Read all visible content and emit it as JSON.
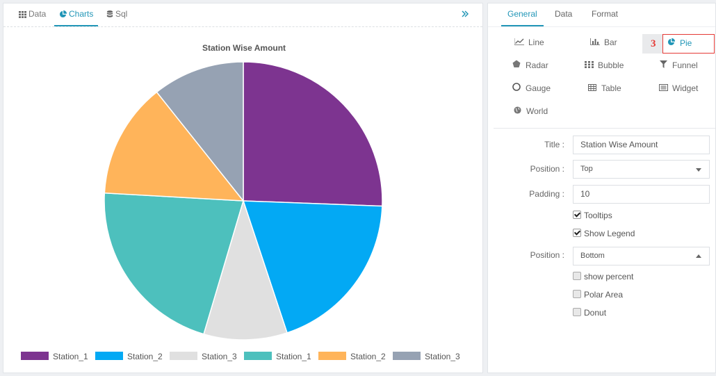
{
  "left_tabs": [
    {
      "label": "Data",
      "icon": "grid-icon"
    },
    {
      "label": "Charts",
      "icon": "pie-chart-icon"
    },
    {
      "label": "Sql",
      "icon": "database-icon"
    }
  ],
  "chart_data": {
    "type": "pie",
    "title": "Station Wise Amount",
    "legend_position": "bottom",
    "categories": [
      "Station_1",
      "Station_2",
      "Station_3",
      "Station_1",
      "Station_2",
      "Station_3"
    ],
    "values": [
      25.6,
      19.3,
      9.7,
      21.3,
      13.4,
      10.7
    ],
    "colors": [
      "#7d3490",
      "#03a9f4",
      "#e0e0e0",
      "#4dc0bd",
      "#ffb45a",
      "#96a2b3"
    ]
  },
  "right_tabs": [
    "General",
    "Data",
    "Format"
  ],
  "chart_types": [
    {
      "label": "Line",
      "icon": "line-chart-icon"
    },
    {
      "label": "Bar",
      "icon": "bar-chart-icon"
    },
    {
      "label": "Pie",
      "icon": "pie-chart-icon",
      "selected": true
    },
    {
      "label": "Radar",
      "icon": "radar-icon"
    },
    {
      "label": "Bubble",
      "icon": "bubble-icon"
    },
    {
      "label": "Funnel",
      "icon": "funnel-icon"
    },
    {
      "label": "Gauge",
      "icon": "gauge-icon"
    },
    {
      "label": "Table",
      "icon": "table-icon"
    },
    {
      "label": "Widget",
      "icon": "widget-icon"
    },
    {
      "label": "World",
      "icon": "globe-icon"
    }
  ],
  "step_marker": "3",
  "form": {
    "title_label": "Title :",
    "title_value": "Station Wise Amount",
    "position_label": "Position :",
    "position_value": "Top",
    "padding_label": "Padding :",
    "padding_value": "10",
    "tooltips_label": "Tooltips",
    "tooltips_checked": true,
    "show_legend_label": "Show Legend",
    "show_legend_checked": true,
    "legend_position_label": "Position :",
    "legend_position_value": "Bottom",
    "show_percent_label": "show percent",
    "polar_area_label": "Polar Area",
    "donut_label": "Donut"
  }
}
